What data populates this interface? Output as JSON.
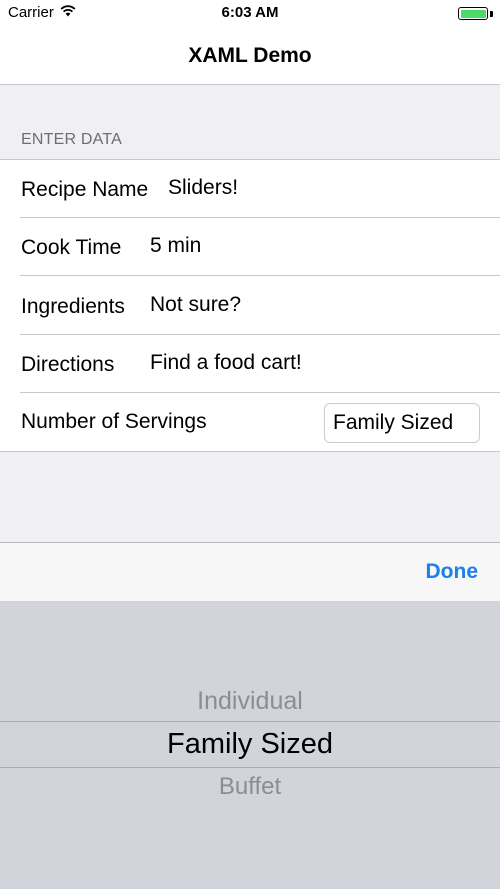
{
  "status_bar": {
    "carrier": "Carrier",
    "time": "6:03 AM",
    "battery_level": 1.0,
    "battery_color": "#4cd964"
  },
  "nav": {
    "title": "XAML Demo"
  },
  "section": {
    "header": "ENTER DATA"
  },
  "rows": [
    {
      "label": "Recipe Name",
      "value": "Sliders!"
    },
    {
      "label": "Cook Time",
      "value": "5 min"
    },
    {
      "label": "Ingredients",
      "value": "Not sure?"
    },
    {
      "label": "Directions",
      "value": "Find a food cart!"
    },
    {
      "label": "Number of Servings",
      "value": "Family Sized"
    }
  ],
  "toolbar": {
    "done_label": "Done",
    "accent_color": "#1a7ff0"
  },
  "picker": {
    "options": [
      "Individual",
      "Family Sized",
      "Buffet"
    ],
    "selected": "Family Sized"
  },
  "icons": {
    "wifi": "wifi-icon",
    "battery": "battery-icon"
  }
}
